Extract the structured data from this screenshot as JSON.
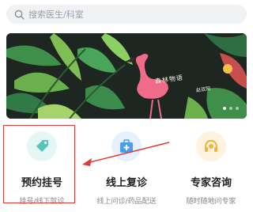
{
  "search": {
    "placeholder": "搜索医生/科室"
  },
  "banner": {
    "caption": "森林物语",
    "signature": "赵双阳"
  },
  "services": [
    {
      "title": "预约挂号",
      "subtitle": "挂号/线下就诊",
      "icon": "tag-icon",
      "color": "#56c6bd"
    },
    {
      "title": "线上复诊",
      "subtitle": "线上问诊/药品配送",
      "icon": "medical-kit-icon",
      "color": "#4a9ef2"
    },
    {
      "title": "专家咨询",
      "subtitle": "随时随地问专家",
      "icon": "headset-icon",
      "color": "#f0b53c"
    }
  ],
  "annotation": {
    "highlight_color": "#e03a3a"
  }
}
